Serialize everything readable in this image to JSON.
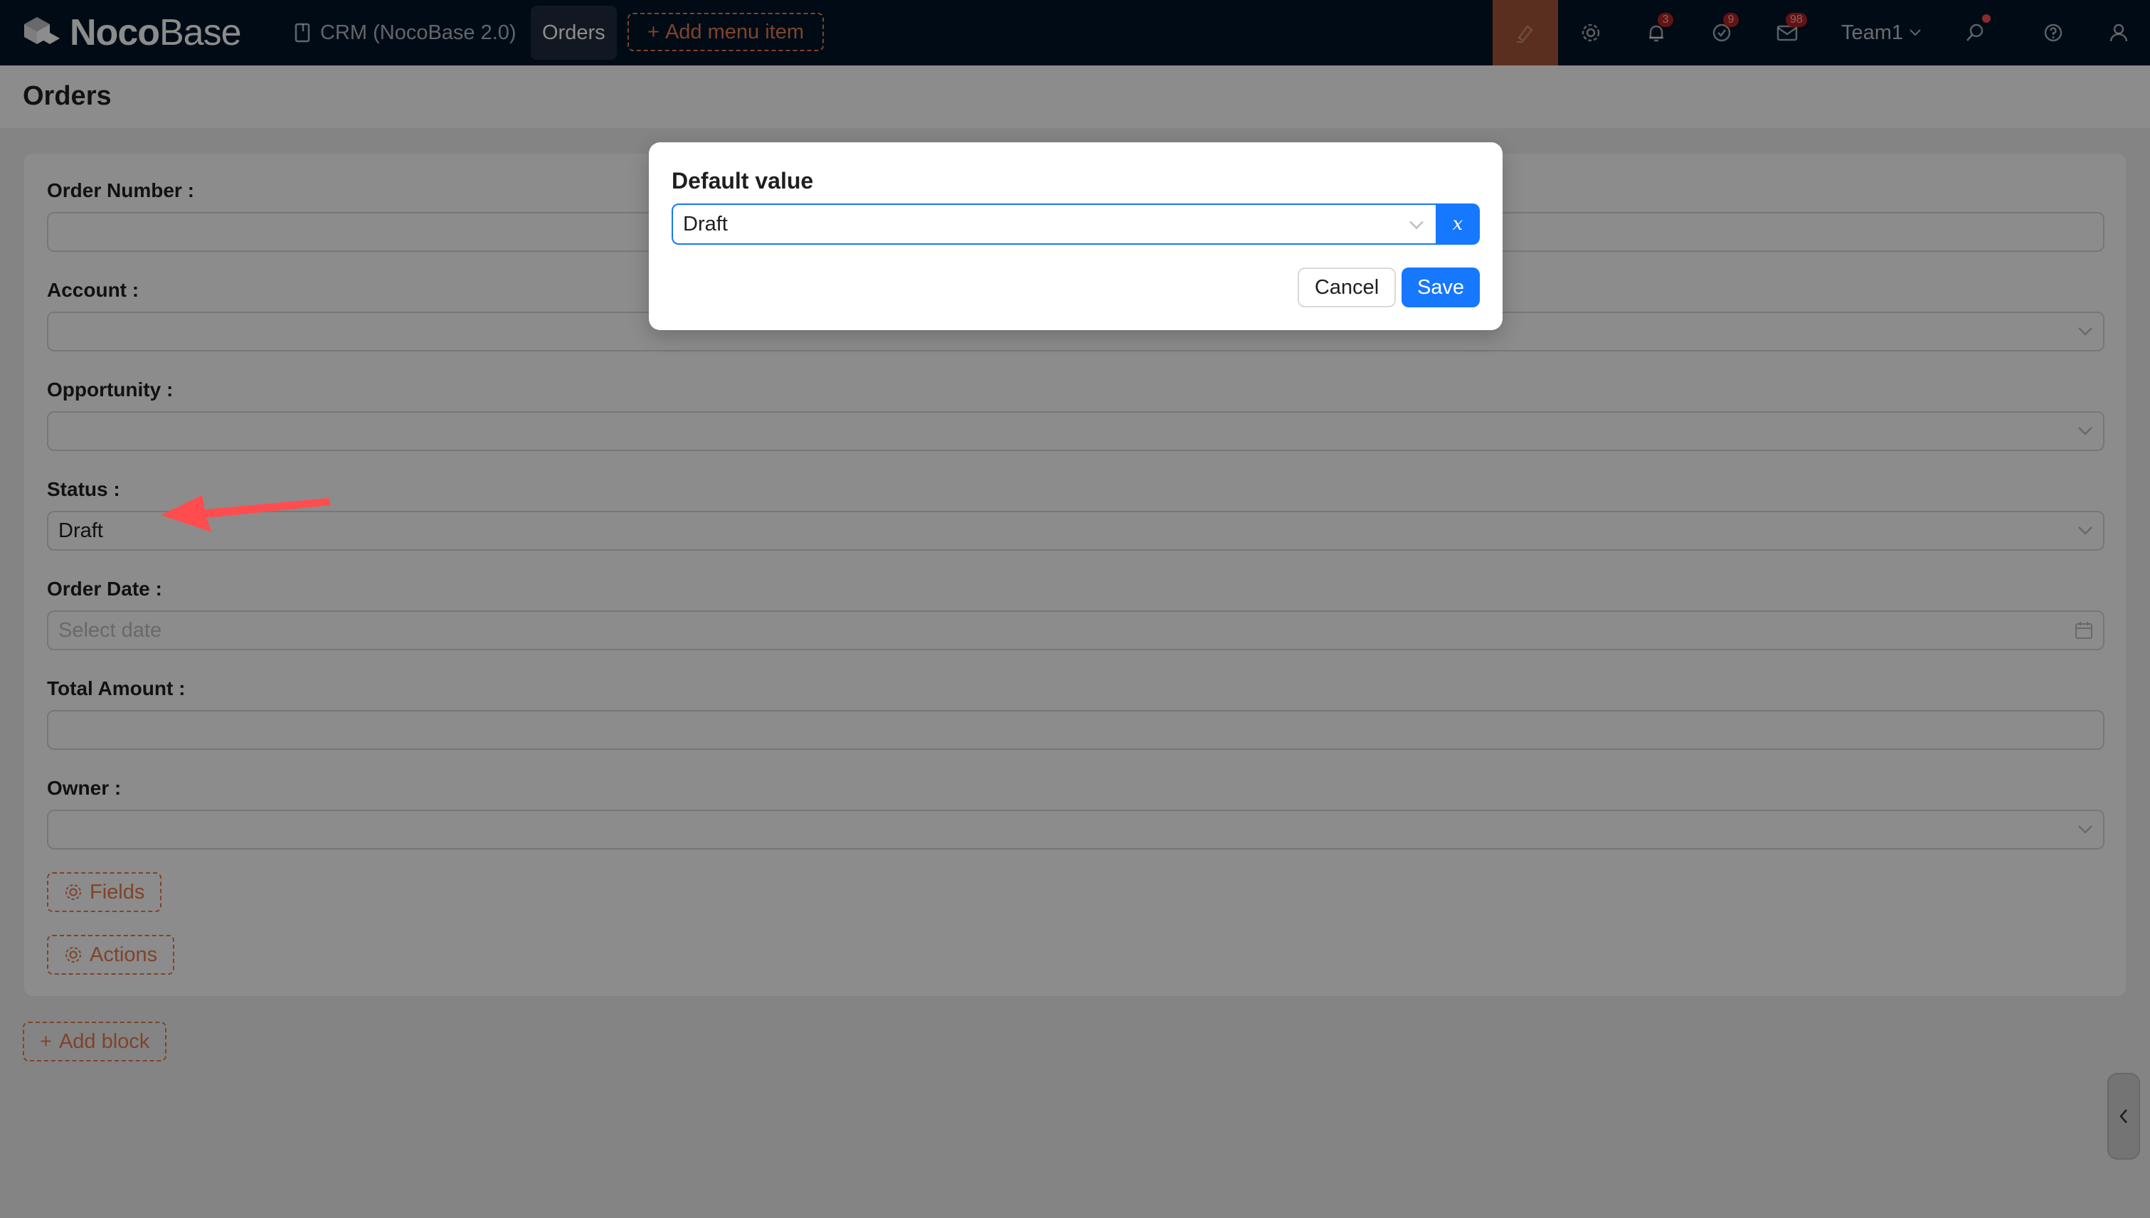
{
  "app": {
    "logo_bold": "Noco",
    "logo_light": "Base"
  },
  "nav": {
    "crm_label": "CRM (NocoBase 2.0)",
    "orders_label": "Orders",
    "add_menu_label": "Add menu item"
  },
  "toolbar": {
    "notifications_badge": "3",
    "tasks_badge": "9",
    "mail_badge": "98",
    "team_label": "Team1"
  },
  "page": {
    "title": "Orders"
  },
  "form": {
    "fields": [
      {
        "label": "Order Number :",
        "value": "",
        "placeholder": "",
        "control": "text"
      },
      {
        "label": "Account :",
        "value": "",
        "placeholder": "",
        "control": "select"
      },
      {
        "label": "Opportunity :",
        "value": "",
        "placeholder": "",
        "control": "select"
      },
      {
        "label": "Status :",
        "value": "Draft",
        "placeholder": "",
        "control": "select"
      },
      {
        "label": "Order Date :",
        "value": "",
        "placeholder": "Select date",
        "control": "date"
      },
      {
        "label": "Total Amount :",
        "value": "",
        "placeholder": "",
        "control": "text"
      },
      {
        "label": "Owner :",
        "value": "",
        "placeholder": "",
        "control": "select"
      }
    ],
    "fields_button": "Fields",
    "actions_button": "Actions"
  },
  "add_block_label": "Add block",
  "modal": {
    "title": "Default value",
    "select_value": "Draft",
    "variable_button": "x",
    "cancel_label": "Cancel",
    "save_label": "Save"
  },
  "colors": {
    "primary": "#1677ff",
    "design_accent": "#e87a4f",
    "topbar_bg": "#001529",
    "annotation_arrow": "#ff4d4f"
  }
}
